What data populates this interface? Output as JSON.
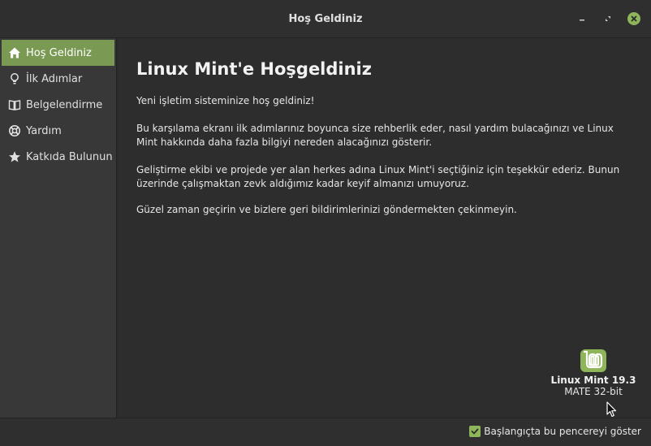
{
  "window": {
    "title": "Hoş Geldiniz"
  },
  "sidebar": {
    "items": [
      {
        "label": "Hoş Geldiniz",
        "icon": "home-icon",
        "active": true
      },
      {
        "label": "İlk Adımlar",
        "icon": "lightbulb-icon",
        "active": false
      },
      {
        "label": "Belgelendirme",
        "icon": "book-icon",
        "active": false
      },
      {
        "label": "Yardım",
        "icon": "lifebuoy-icon",
        "active": false
      },
      {
        "label": "Katkıda Bulunun",
        "icon": "star-icon",
        "active": false
      }
    ]
  },
  "main": {
    "heading": "Linux Mint'e Hoşgeldiniz",
    "paragraphs": [
      "Yeni işletim sisteminize hoş geldiniz!",
      "Bu karşılama ekranı ilk adımlarınız boyunca size rehberlik eder, nasıl yardım bulacağınızı ve Linux Mint hakkında daha fazla bilgiyi nereden alacağınızı gösterir.",
      "Geliştirme ekibi ve projede yer alan herkes adına Linux Mint'i seçtiğiniz için teşekkür ederiz. Bunun üzerinde çalışmaktan zevk aldığımız kadar keyif almanızı umuyoruz.",
      "Güzel zaman geçirin ve bizlere geri bildirimlerinizi göndermekten çekinmeyin."
    ],
    "version": "Linux Mint 19.3",
    "edition": "MATE 32-bit"
  },
  "footer": {
    "startup_label": "Başlangıçta bu pencereyi göster",
    "startup_checked": true
  },
  "colors": {
    "accent": "#8fb55b",
    "sidebar_active": "#7a9a53",
    "background": "#2d2d2d",
    "sidebar_bg": "#383838"
  }
}
